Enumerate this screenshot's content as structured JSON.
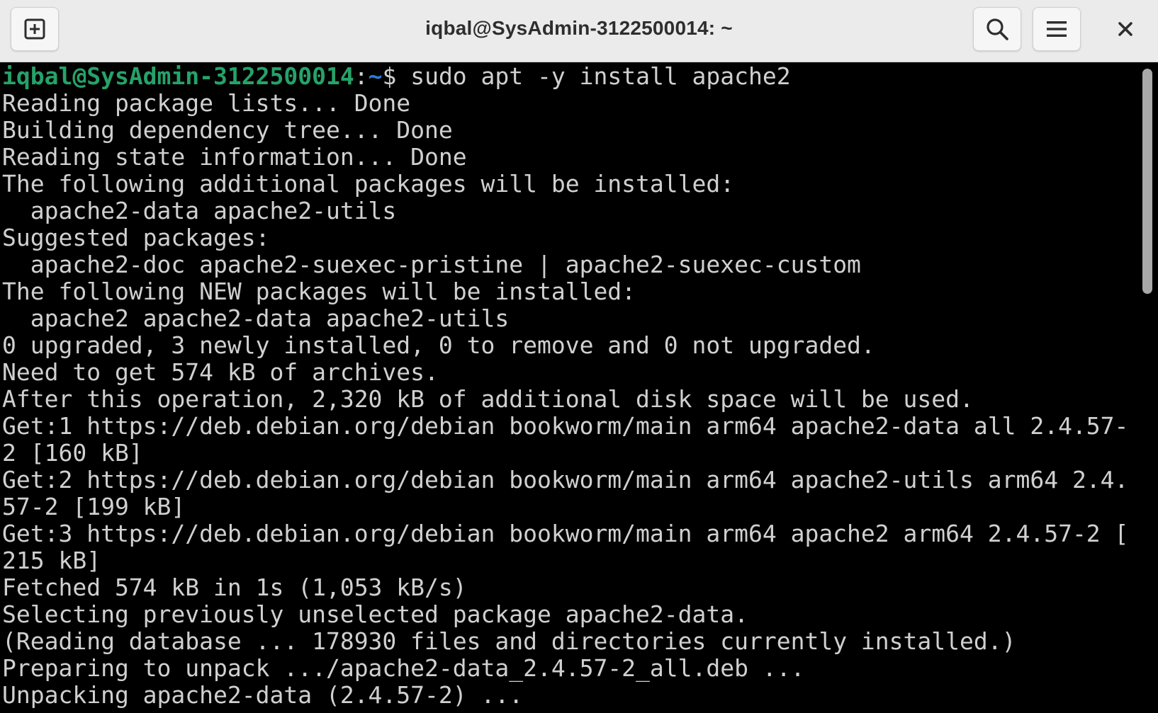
{
  "window": {
    "title": "iqbal@SysAdmin-3122500014: ~"
  },
  "header": {
    "new_tab_icon": "new-tab-icon",
    "search_icon": "search-icon",
    "menu_icon": "hamburger-menu-icon",
    "close_icon": "close-icon"
  },
  "terminal": {
    "prompt_user_host": "iqbal@SysAdmin-3122500014",
    "prompt_sep": ":",
    "prompt_path": "~",
    "prompt_symbol": "$ ",
    "command": "sudo apt -y install apache2",
    "lines": [
      "Reading package lists... Done",
      "Building dependency tree... Done",
      "Reading state information... Done",
      "The following additional packages will be installed:",
      "  apache2-data apache2-utils",
      "Suggested packages:",
      "  apache2-doc apache2-suexec-pristine | apache2-suexec-custom",
      "The following NEW packages will be installed:",
      "  apache2 apache2-data apache2-utils",
      "0 upgraded, 3 newly installed, 0 to remove and 0 not upgraded.",
      "Need to get 574 kB of archives.",
      "After this operation, 2,320 kB of additional disk space will be used.",
      "Get:1 https://deb.debian.org/debian bookworm/main arm64 apache2-data all 2.4.57-",
      "2 [160 kB]",
      "Get:2 https://deb.debian.org/debian bookworm/main arm64 apache2-utils arm64 2.4.",
      "57-2 [199 kB]",
      "Get:3 https://deb.debian.org/debian bookworm/main arm64 apache2 arm64 2.4.57-2 [",
      "215 kB]",
      "Fetched 574 kB in 1s (1,053 kB/s)",
      "Selecting previously unselected package apache2-data.",
      "(Reading database ... 178930 files and directories currently installed.)",
      "Preparing to unpack .../apache2-data_2.4.57-2_all.deb ...",
      "Unpacking apache2-data (2.4.57-2) ..."
    ]
  },
  "colors": {
    "titlebar_bg": "#ebebeb",
    "terminal_bg": "#000000",
    "terminal_fg": "#d0d0d0",
    "prompt_user": "#26a269",
    "prompt_path": "#2a7bde"
  }
}
